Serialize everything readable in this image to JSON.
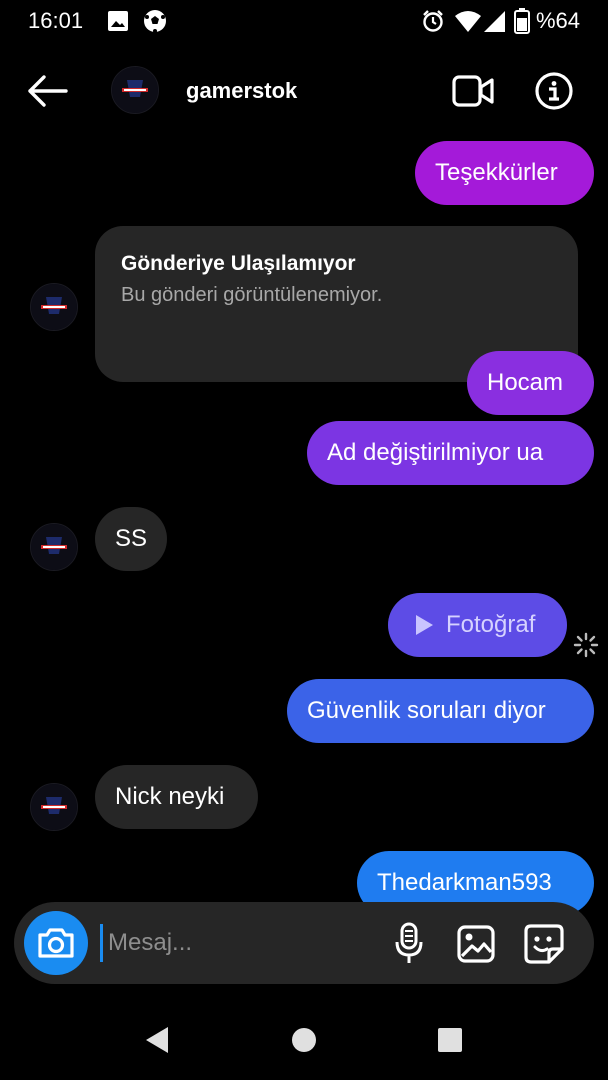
{
  "status_bar": {
    "time": "16:01",
    "battery": "%64"
  },
  "header": {
    "username": "gamerstok"
  },
  "messages": [
    {
      "side": "sent",
      "text": "Teşekkürler"
    },
    {
      "side": "received",
      "title": "Gönderiye Ulaşılamıyor",
      "text": "Bu gönderi görüntülenemiyor."
    },
    {
      "side": "sent",
      "text": "Hocam"
    },
    {
      "side": "sent",
      "text": "Ad değiştirilmiyor ua"
    },
    {
      "side": "received",
      "text": "SS"
    },
    {
      "side": "sent",
      "text": "Fotoğraf"
    },
    {
      "side": "sent",
      "text": "Güvenlik soruları diyor"
    },
    {
      "side": "received",
      "text": "Nick neyki"
    },
    {
      "side": "sent",
      "text": "Thedarkman593"
    }
  ],
  "composer": {
    "placeholder": "Mesaj..."
  },
  "colors": {
    "purple": "#a41ad9",
    "violet": "#8a2fe0",
    "indigo": "#5d4ce6",
    "blue": "#3b63e8",
    "azure": "#1f7cf0",
    "accent": "#1a8cf1"
  }
}
